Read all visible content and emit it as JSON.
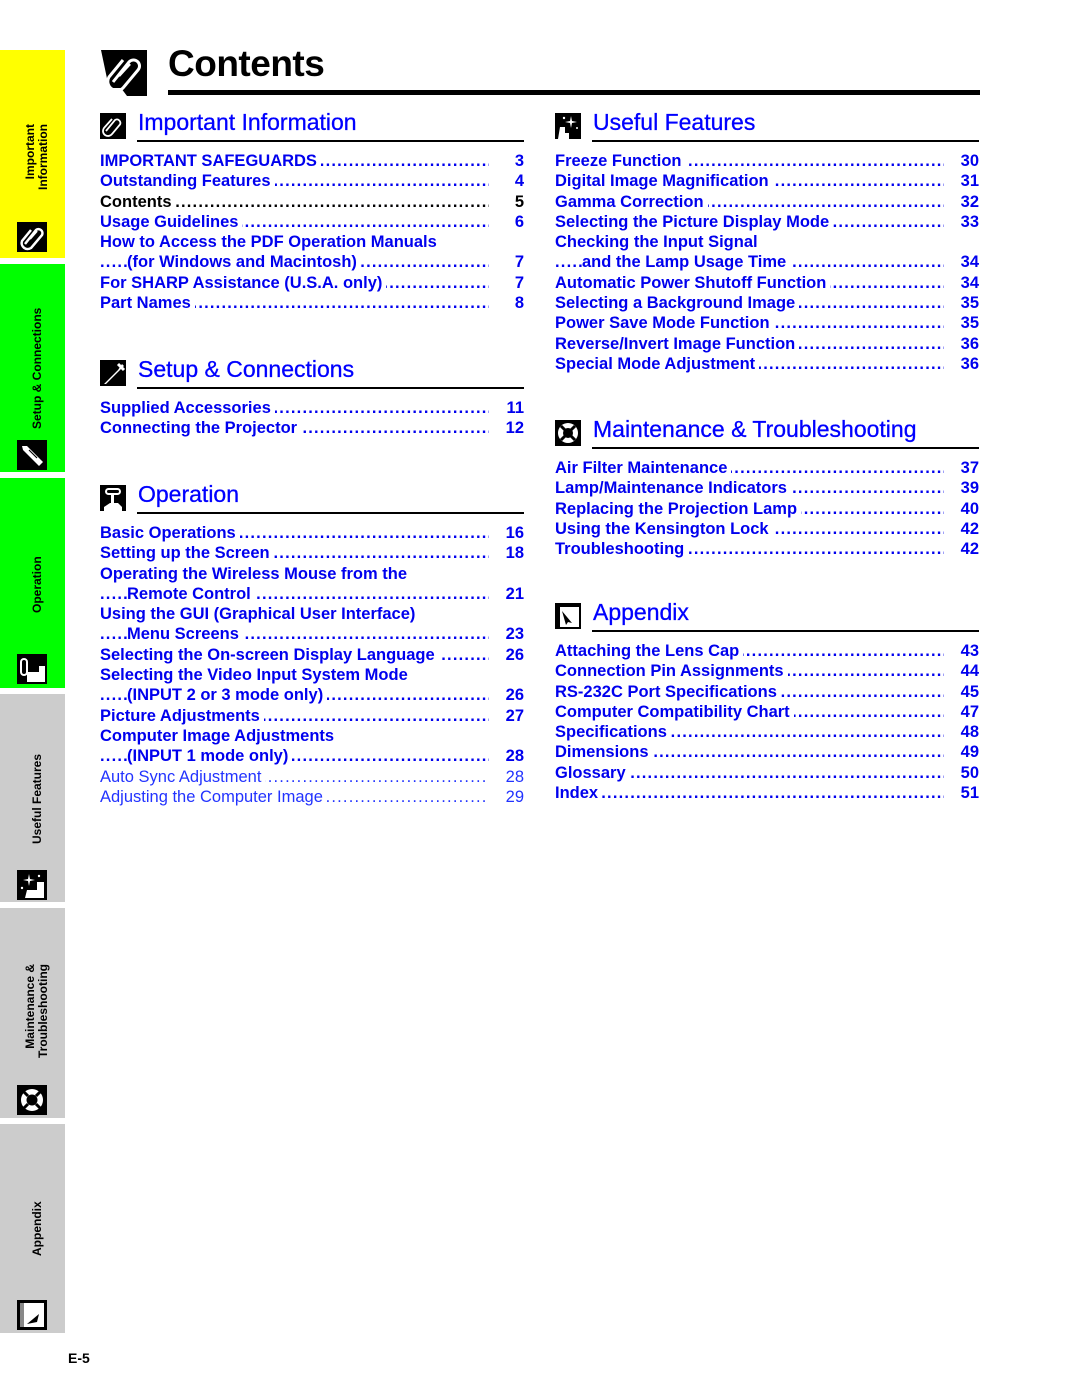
{
  "page": {
    "title": "Contents",
    "title_icon": "paperclip-icon",
    "page_number": "E-5",
    "colors": {
      "link_blue": "#0000ee",
      "tab_yellow": "#ffff00",
      "tab_green": "#00ff00",
      "tab_gray": "#cccccc"
    }
  },
  "side_tabs": [
    {
      "lines": [
        "Important",
        "Information"
      ],
      "icon": "paperclip-icon",
      "color": "#ffff00"
    },
    {
      "lines": [
        "Setup & Connections"
      ],
      "icon": "connector-plug-icon",
      "color": "#00ff00"
    },
    {
      "lines": [
        "Operation"
      ],
      "icon": "finger-press-icon",
      "color": "#00ff00"
    },
    {
      "lines": [
        "Useful Features"
      ],
      "icon": "sparkle-hand-icon",
      "color": "#cccccc"
    },
    {
      "lines": [
        "Maintenance &",
        "Troubleshooting"
      ],
      "icon": "lifebuoy-icon",
      "color": "#cccccc"
    },
    {
      "lines": [
        "Appendix"
      ],
      "icon": "folded-corner-page-icon",
      "color": "#cccccc"
    }
  ],
  "sections": {
    "important": {
      "title": "Important Information",
      "icon": "paperclip-icon",
      "entries": [
        {
          "text": "IMPORTANT SAFEGUARDS",
          "page": "3"
        },
        {
          "text": "Outstanding Features",
          "page": "4"
        },
        {
          "text": "Contents",
          "page": "5"
        },
        {
          "text": "Usage Guidelines",
          "page": "6"
        },
        {
          "text": "How to Access the PDF Operation Manuals",
          "page": ""
        },
        {
          "text": "(for Windows and Macintosh)",
          "page": "7"
        },
        {
          "text": "For SHARP Assistance (U.S.A. only)",
          "page": "7"
        },
        {
          "text": "Part Names",
          "page": "8"
        }
      ]
    },
    "setup": {
      "title": "Setup & Connections",
      "icon": "connector-plug-icon",
      "entries": [
        {
          "text": "Supplied Accessories",
          "page": "11"
        },
        {
          "text": "Connecting the Projector",
          "page": "12"
        }
      ]
    },
    "operation": {
      "title": "Operation",
      "icon": "finger-press-icon",
      "entries": [
        {
          "text": "Basic Operations",
          "page": "16"
        },
        {
          "text": "Setting up the Screen",
          "page": "18"
        },
        {
          "text": "Operating the Wireless Mouse from the",
          "page": ""
        },
        {
          "text": "Remote Control",
          "page": "21"
        },
        {
          "text": "Using the GUI (Graphical User Interface)",
          "page": ""
        },
        {
          "text": "Menu Screens",
          "page": "23"
        },
        {
          "text": "Selecting the On-screen Display Language",
          "page": "26"
        },
        {
          "text": "Selecting the Video Input System Mode",
          "page": ""
        },
        {
          "text": "(INPUT 2 or 3 mode only)",
          "page": "26"
        },
        {
          "text": "Picture Adjustments",
          "page": "27"
        },
        {
          "text": "Computer Image Adjustments",
          "page": ""
        },
        {
          "text": "(INPUT 1 mode only)",
          "page": "28"
        },
        {
          "text": "Auto Sync Adjustment",
          "page": "28"
        },
        {
          "text": "Adjusting the Computer Image",
          "page": "29"
        }
      ]
    },
    "useful": {
      "title": "Useful Features",
      "icon": "sparkle-hand-icon",
      "entries": [
        {
          "text": "Freeze Function",
          "page": "30"
        },
        {
          "text": "Digital Image Magnification",
          "page": "31"
        },
        {
          "text": "Gamma Correction",
          "page": "32"
        },
        {
          "text": "Selecting the Picture Display Mode",
          "page": "33"
        },
        {
          "text": "Checking the Input Signal",
          "page": ""
        },
        {
          "text": "and the Lamp Usage Time",
          "page": "34"
        },
        {
          "text": "Automatic Power Shutoff Function",
          "page": "34"
        },
        {
          "text": "Selecting a Background Image",
          "page": "35"
        },
        {
          "text": "Power Save Mode Function",
          "page": "35"
        },
        {
          "text": "Reverse/Invert Image Function",
          "page": "36"
        },
        {
          "text": "Special Mode Adjustment",
          "page": "36"
        }
      ]
    },
    "maintenance": {
      "title": "Maintenance & Troubleshooting",
      "icon": "lifebuoy-icon",
      "entries": [
        {
          "text": "Air Filter Maintenance",
          "page": "37"
        },
        {
          "text": "Lamp/Maintenance Indicators",
          "page": "39"
        },
        {
          "text": "Replacing the Projection Lamp",
          "page": "40"
        },
        {
          "text": "Using the Kensington Lock",
          "page": "42"
        },
        {
          "text": "Troubleshooting",
          "page": "42"
        }
      ]
    },
    "appendix": {
      "title": "Appendix",
      "icon": "folded-corner-page-icon",
      "entries": [
        {
          "text": "Attaching the Lens Cap",
          "page": "43"
        },
        {
          "text": "Connection Pin Assignments",
          "page": "44"
        },
        {
          "text": "RS-232C Port Specifications",
          "page": "45"
        },
        {
          "text": "Computer Compatibility Chart",
          "page": "47"
        },
        {
          "text": "Specifications",
          "page": "48"
        },
        {
          "text": "Dimensions",
          "page": "49"
        },
        {
          "text": "Glossary",
          "page": "50"
        },
        {
          "text": "Index",
          "page": "51"
        }
      ]
    }
  }
}
